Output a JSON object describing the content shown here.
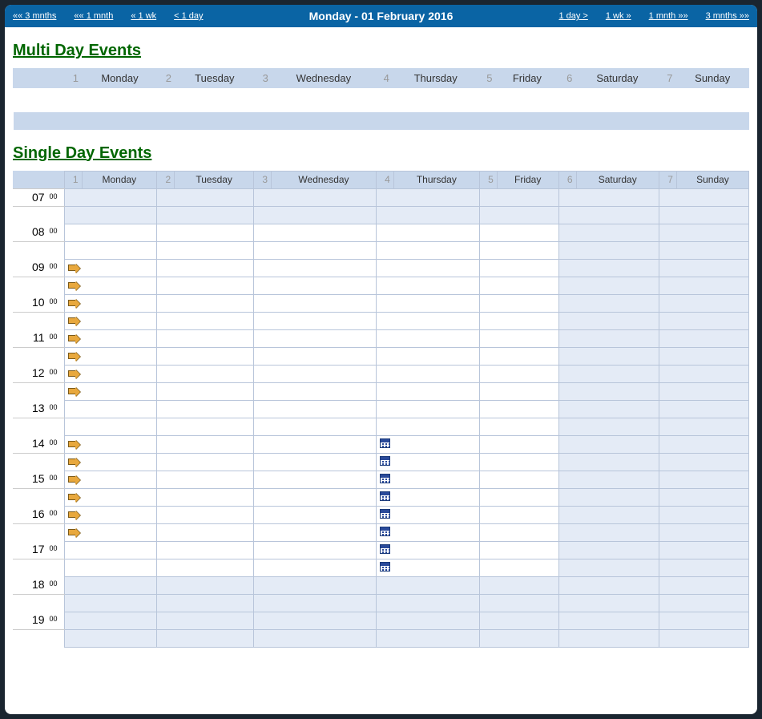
{
  "nav": {
    "back3m": "«« 3 mnths",
    "back1m": "«« 1 mnth",
    "back1w": "« 1 wk",
    "back1d": "< 1 day",
    "title": "Monday - 01 February 2016",
    "fwd1d": "1 day >",
    "fwd1w": "1 wk »",
    "fwd1m": "1 mnth »»",
    "fwd3m": "3 mnths »»"
  },
  "sections": {
    "multi": "Multi Day Events",
    "single": "Single Day Events"
  },
  "days": [
    {
      "num": "1",
      "name": "Monday"
    },
    {
      "num": "2",
      "name": "Tuesday"
    },
    {
      "num": "3",
      "name": "Wednesday"
    },
    {
      "num": "4",
      "name": "Thursday"
    },
    {
      "num": "5",
      "name": "Friday"
    },
    {
      "num": "6",
      "name": "Saturday"
    },
    {
      "num": "7",
      "name": "Sunday"
    }
  ],
  "weekend_cols": [
    5,
    6
  ],
  "hours": [
    "07",
    "08",
    "09",
    "10",
    "11",
    "12",
    "13",
    "14",
    "15",
    "16",
    "17",
    "18",
    "19"
  ],
  "minutes": "00",
  "shaded_hours": [
    "07",
    "18",
    "19"
  ],
  "row_events": {
    "09:00": {
      "monday_arrow": true
    },
    "09:30": {
      "monday_arrow": true
    },
    "10:00": {
      "monday_arrow": true
    },
    "10:30": {
      "monday_arrow": true
    },
    "11:00": {
      "monday_arrow": true
    },
    "11:30": {
      "monday_arrow": true
    },
    "12:00": {
      "monday_arrow": true
    },
    "12:30": {
      "monday_arrow": true
    },
    "14:00": {
      "monday_arrow": true,
      "thursday_cal": true
    },
    "14:30": {
      "monday_arrow": true,
      "thursday_cal": true
    },
    "15:00": {
      "monday_arrow": true,
      "thursday_cal": true
    },
    "15:30": {
      "monday_arrow": true,
      "thursday_cal": true
    },
    "16:00": {
      "monday_arrow": true,
      "thursday_cal": true
    },
    "16:30": {
      "monday_arrow": true,
      "thursday_cal": true
    },
    "17:00": {
      "thursday_cal": true
    },
    "17:30": {
      "thursday_cal": true
    }
  }
}
